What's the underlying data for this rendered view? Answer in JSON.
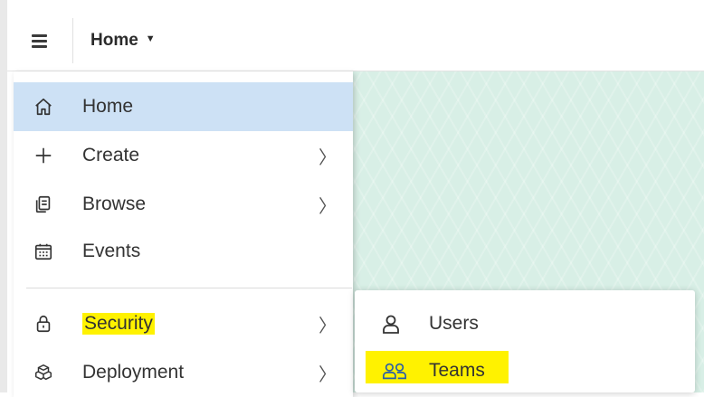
{
  "topbar": {
    "current_page": "Home",
    "caret": "▼"
  },
  "main_menu": {
    "items": [
      {
        "label": "Home",
        "icon": "home-icon",
        "active": true
      },
      {
        "label": "Create",
        "icon": "plus-icon",
        "chevron": "〉"
      },
      {
        "label": "Browse",
        "icon": "browse-icon",
        "chevron": "〉"
      },
      {
        "label": "Events",
        "icon": "calendar-icon"
      },
      {
        "label": "Security",
        "icon": "lock-icon",
        "chevron": "〉",
        "highlighted": true
      },
      {
        "label": "Deployment",
        "icon": "deployment-icon",
        "chevron": "〉"
      }
    ]
  },
  "security_submenu": {
    "items": [
      {
        "label": "Users",
        "icon": "user-icon"
      },
      {
        "label": "Teams",
        "icon": "team-icon",
        "highlighted": true
      }
    ]
  },
  "colors": {
    "active_item_bg": "#cde1f5",
    "highlight": "#fff200",
    "background_pattern": "#d8efe6",
    "teams_icon": "#2a5ea8"
  }
}
